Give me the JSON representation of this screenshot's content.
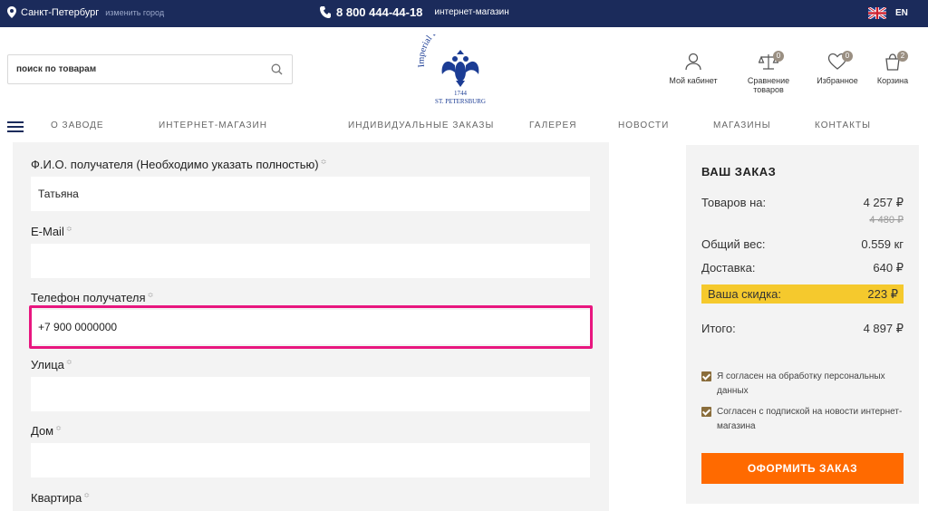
{
  "topbar": {
    "city": "Санкт-Петербург",
    "change_city": "изменить город",
    "phone": "8 800 444-44-18",
    "phone_note": "интернет-магазин",
    "lang": "EN"
  },
  "search": {
    "placeholder": "поиск по товарам"
  },
  "logo": {
    "top_text": "Imperial Porcelain",
    "year": "1744",
    "city": "St. Petersburg"
  },
  "header_icons": [
    {
      "label": "Мой кабинет",
      "icon": "user-icon"
    },
    {
      "label": "Сравнение товаров",
      "icon": "scales-icon",
      "badge": "0"
    },
    {
      "label": "Избранное",
      "icon": "heart-icon",
      "badge": "0"
    },
    {
      "label": "Корзина",
      "icon": "bag-icon",
      "badge": "2"
    }
  ],
  "nav": [
    "О ЗАВОДЕ",
    "ИНТЕРНЕТ-МАГАЗИН",
    "ИНДИВИДУАЛЬНЫЕ ЗАКАЗЫ",
    "ГАЛЕРЕЯ",
    "НОВОСТИ",
    "МАГАЗИНЫ",
    "КОНТАКТЫ"
  ],
  "form": {
    "req_mark": "≎",
    "fields": [
      {
        "label": "Ф.И.О. получателя (Необходимо указать полностью)",
        "value": "Татьяна"
      },
      {
        "label": "E-Mail",
        "value": ""
      },
      {
        "label": "Телефон получателя",
        "value": "+7 900 0000000"
      },
      {
        "label": "Улица",
        "value": ""
      },
      {
        "label": "Дом",
        "value": ""
      },
      {
        "label": "Квартира",
        "value": ""
      }
    ]
  },
  "order": {
    "title": "ВАШ ЗАКАЗ",
    "goods_label": "Товаров на:",
    "goods_value": "4 257 ₽",
    "goods_old": "4 480 ₽",
    "weight_label": "Общий вес:",
    "weight_value": "0.559 кг",
    "delivery_label": "Доставка:",
    "delivery_value": "640 ₽",
    "discount_label": "Ваша скидка:",
    "discount_value": "223 ₽",
    "total_label": "Итого:",
    "total_value": "4 897 ₽",
    "consent_personal": "Я согласен на обработку персональных данных",
    "consent_news": "Согласен с подпиской на новости интернет-магазина",
    "submit": "ОФОРМИТЬ ЗАКАЗ"
  },
  "colors": {
    "topbar": "#1b2b5b",
    "highlight": "#e8167f",
    "discount": "#f5c92d",
    "submit": "#ff6a00",
    "checkbox": "#8a6d3b"
  }
}
